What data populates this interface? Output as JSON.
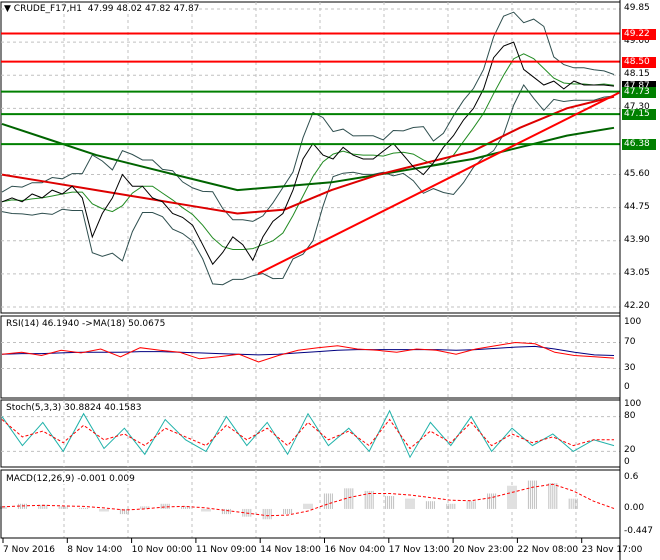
{
  "header": {
    "symbol_label": "CRUDE_F17,H1",
    "ohlc": "47.99 48.02 47.82 47.87"
  },
  "colors": {
    "up_line": "#ff0000",
    "down_line": "#008000",
    "price": "#000000",
    "bands": "#2f4f4f",
    "rsi": "#ff0000",
    "rsi_ma": "#000080",
    "stoch_main": "#20b2aa",
    "stoch_signal": "#ff0000",
    "macd_hist": "#c0c0c0",
    "macd_signal": "#ff0000"
  },
  "chart_data": [
    {
      "type": "line",
      "title": "CRUDE_F17,H1",
      "ylim": [
        42.2,
        49.85
      ],
      "y_ticks": [
        "49.85",
        "49.00",
        "48.15",
        "47.30",
        "45.60",
        "44.75",
        "43.90",
        "43.05",
        "42.20"
      ],
      "x_tick_labels": [
        "7 Nov 2016",
        "8 Nov 14:00",
        "10 Nov 00:00",
        "11 Nov 09:00",
        "14 Nov 18:00",
        "16 Nov 04:00",
        "17 Nov 13:00",
        "20 Nov 23:00",
        "22 Nov 08:00",
        "23 Nov 17:00"
      ],
      "grid": true,
      "close": [
        44.9,
        45.0,
        44.9,
        45.1,
        45.0,
        45.2,
        45.1,
        45.3,
        45.0,
        44.0,
        44.6,
        45.0,
        45.6,
        45.3,
        45.3,
        45.0,
        44.9,
        44.6,
        44.5,
        44.3,
        43.8,
        43.3,
        43.6,
        44.0,
        43.8,
        43.4,
        44.0,
        44.4,
        44.6,
        45.2,
        46.0,
        46.4,
        46.1,
        46.0,
        46.3,
        46.1,
        46.0,
        46.0,
        46.2,
        46.4,
        46.1,
        45.8,
        45.6,
        45.9,
        46.3,
        46.6,
        47.0,
        47.3,
        47.8,
        48.6,
        48.9,
        49.0,
        48.3,
        48.1,
        47.9,
        48.0,
        47.8,
        48.0,
        47.9,
        47.9,
        47.9,
        47.87
      ],
      "ma_red": [
        45.6,
        45.4,
        45.2,
        45.0,
        44.8,
        44.6,
        44.7,
        45.2,
        45.6,
        45.9,
        46.2,
        46.8,
        47.3,
        47.6
      ],
      "ma_green": [
        46.9,
        46.5,
        46.1,
        45.8,
        45.5,
        45.2,
        45.3,
        45.4,
        45.6,
        45.8,
        46.0,
        46.3,
        46.6,
        46.8
      ],
      "horizontal_levels": [
        {
          "label": "49.22",
          "value": 49.22,
          "color": "#ff0000"
        },
        {
          "label": "48.50",
          "value": 48.5,
          "color": "#ff0000"
        },
        {
          "label": "47.87",
          "value": 47.87,
          "color": "#000000"
        },
        {
          "label": "47.73",
          "value": 47.73,
          "color": "#008000"
        },
        {
          "label": "47.15",
          "value": 47.15,
          "color": "#008000"
        },
        {
          "label": "46.38",
          "value": 46.38,
          "color": "#008000"
        }
      ],
      "trendline": {
        "from": [
          25.5,
          43.05
        ],
        "to": [
          61.5,
          47.7
        ]
      }
    },
    {
      "type": "line",
      "title": "RSI(14) 46.1940  ->MA(18) 50.0675",
      "ylim": [
        0,
        100
      ],
      "y_ticks": [
        "100",
        "70",
        "30",
        "0"
      ],
      "rsi": [
        52,
        55,
        50,
        58,
        54,
        60,
        48,
        62,
        58,
        55,
        45,
        48,
        52,
        40,
        50,
        58,
        62,
        65,
        60,
        58,
        55,
        60,
        58,
        52,
        60,
        65,
        70,
        68,
        55,
        50,
        48,
        46
      ],
      "ma": [
        52,
        53,
        53,
        54,
        55,
        55,
        55,
        56,
        56,
        55,
        54,
        53,
        52,
        51,
        52,
        54,
        56,
        58,
        59,
        59,
        59,
        59,
        59,
        58,
        59,
        61,
        63,
        64,
        60,
        55,
        51,
        50
      ]
    },
    {
      "type": "line",
      "title": "Stoch(5,3,3) 30.8824 40.1583",
      "ylim": [
        0,
        100
      ],
      "y_ticks": [
        "100",
        "80",
        "20",
        "0"
      ],
      "main": [
        80,
        30,
        70,
        20,
        85,
        25,
        60,
        15,
        75,
        40,
        20,
        80,
        30,
        70,
        15,
        85,
        30,
        60,
        20,
        90,
        10,
        70,
        30,
        80,
        20,
        60,
        30,
        50,
        20,
        40,
        30
      ],
      "signal": [
        75,
        45,
        55,
        35,
        65,
        40,
        50,
        30,
        60,
        45,
        30,
        65,
        40,
        60,
        30,
        70,
        40,
        55,
        30,
        75,
        25,
        55,
        35,
        70,
        30,
        50,
        35,
        45,
        30,
        40,
        40
      ]
    },
    {
      "type": "bar",
      "title": "MACD(12,26,9) -0.001 0.009",
      "ylim": [
        -0.447,
        0.6
      ],
      "y_ticks": [
        "0.6",
        "0.00",
        "-0.447"
      ],
      "histogram": [
        0.05,
        0.1,
        0.08,
        0.05,
        0.02,
        -0.05,
        -0.1,
        0.05,
        0.1,
        0.05,
        -0.05,
        -0.1,
        -0.15,
        -0.2,
        -0.1,
        0.1,
        0.3,
        0.4,
        0.35,
        0.25,
        0.2,
        0.15,
        0.1,
        0.15,
        0.3,
        0.45,
        0.55,
        0.5,
        0.2,
        0.0,
        -0.001
      ],
      "signal": [
        0.04,
        0.06,
        0.07,
        0.06,
        0.05,
        0.02,
        -0.02,
        0.0,
        0.04,
        0.05,
        0.02,
        -0.03,
        -0.08,
        -0.13,
        -0.12,
        -0.04,
        0.1,
        0.22,
        0.3,
        0.3,
        0.27,
        0.22,
        0.17,
        0.16,
        0.22,
        0.32,
        0.42,
        0.48,
        0.35,
        0.15,
        0.009
      ]
    }
  ]
}
